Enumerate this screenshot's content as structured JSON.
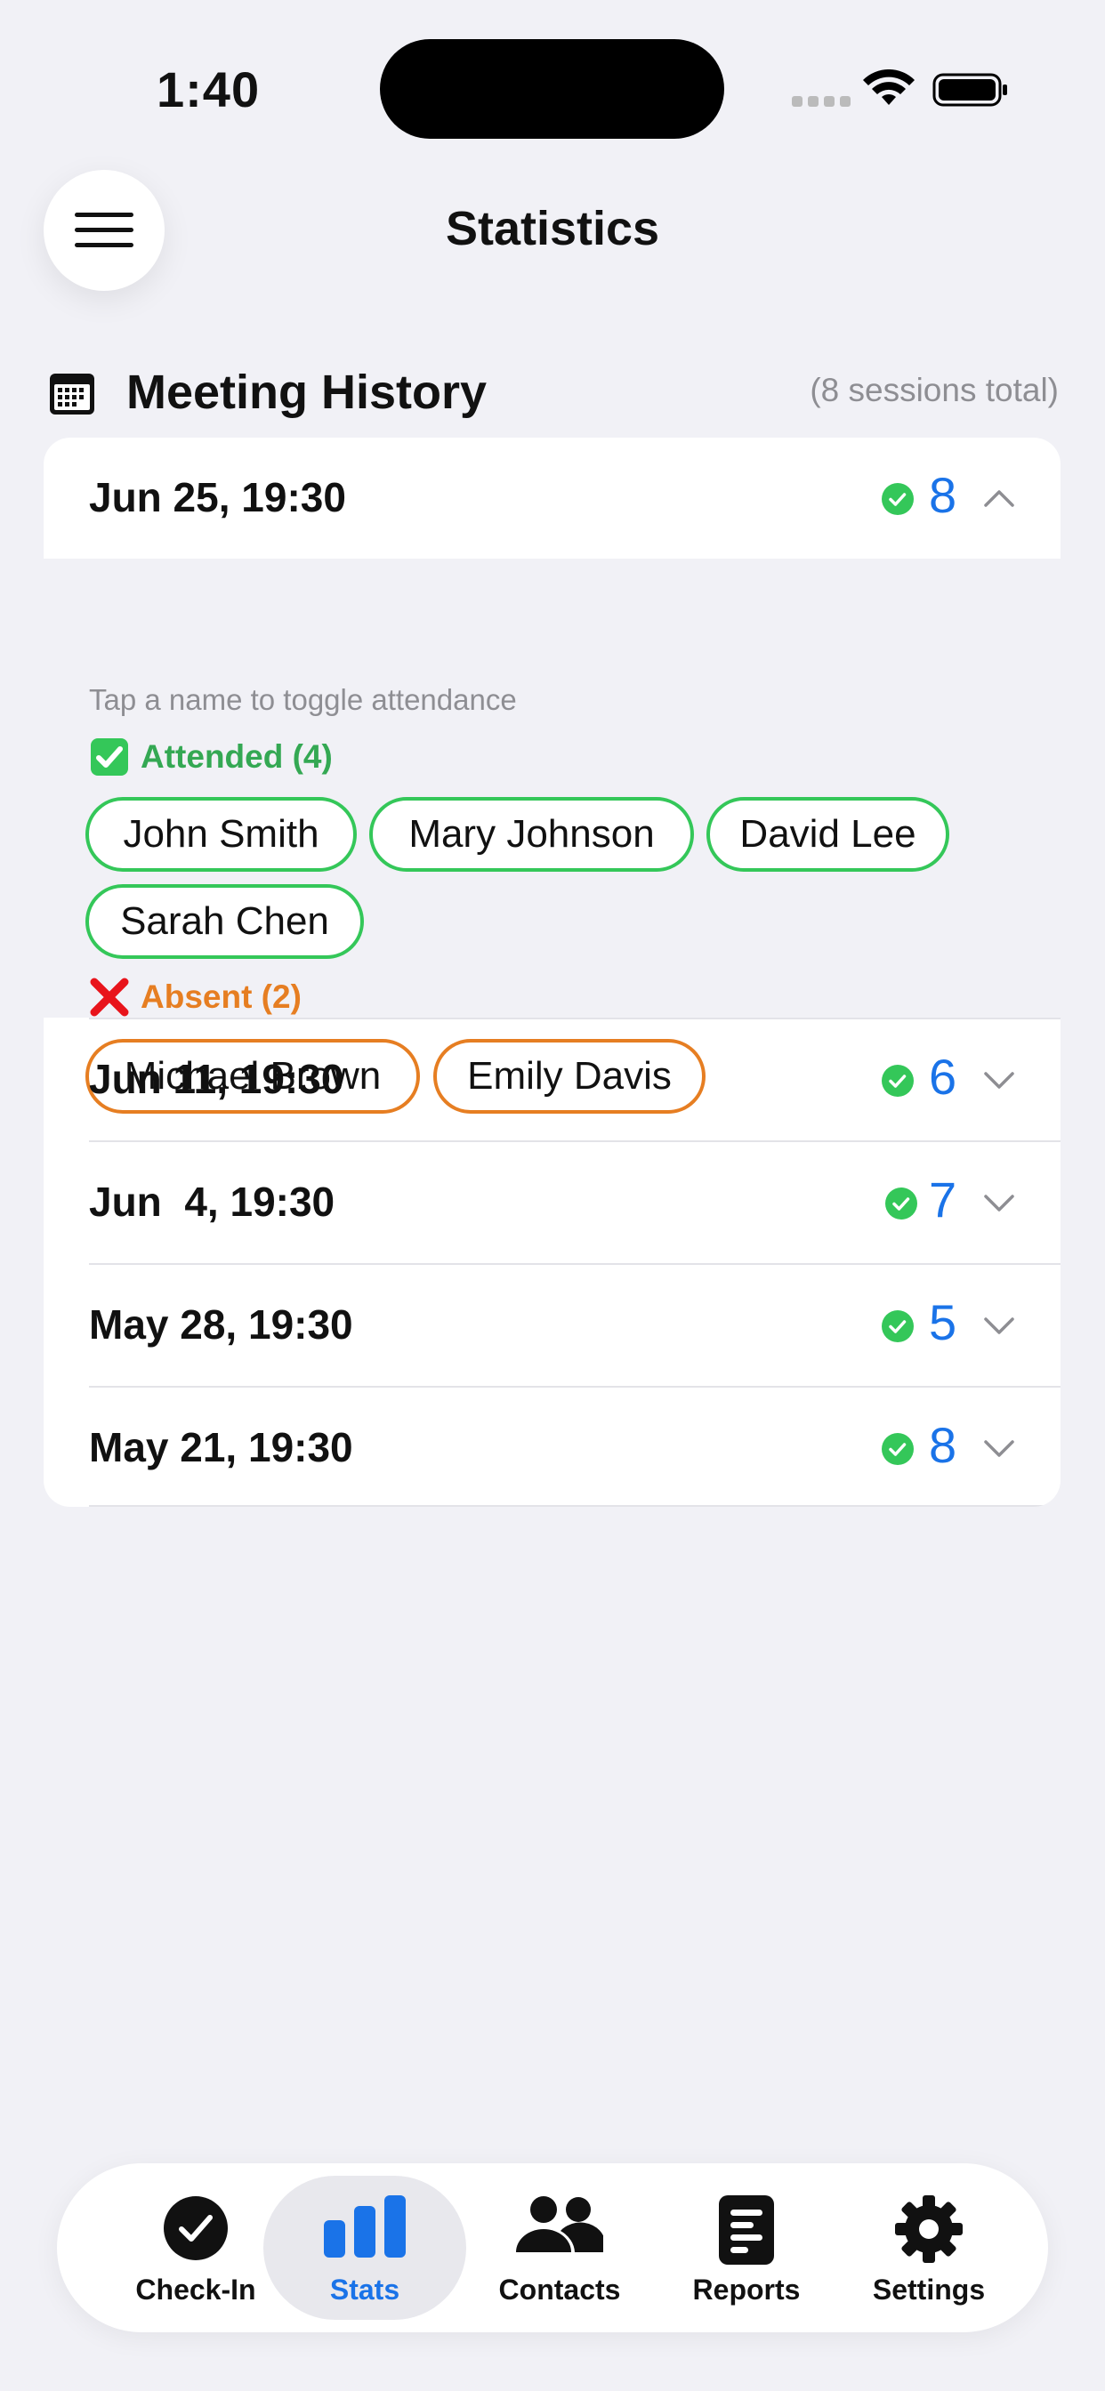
{
  "status_bar": {
    "time": "1:40"
  },
  "nav": {
    "title": "Statistics"
  },
  "section": {
    "title": "Meeting History",
    "count": "(8 sessions total)"
  },
  "sessions": [
    {
      "date": "Jun 25, 19:30",
      "attended_count": "8",
      "expanded": true
    },
    {
      "date": "Jun 11, 19:30",
      "attended_count": "6",
      "expanded": false
    },
    {
      "date": "Jun  4, 19:30",
      "attended_count": "7",
      "expanded": false
    },
    {
      "date": "May 28, 19:30",
      "attended_count": "5",
      "expanded": false
    },
    {
      "date": "May 21, 19:30",
      "attended_count": "8",
      "expanded": false
    }
  ],
  "expanded_session": {
    "hint": "Tap a name to toggle attendance",
    "attended_label": "Attended (4)",
    "attended": [
      "John Smith",
      "Mary Johnson",
      "David Lee",
      "Sarah Chen"
    ],
    "absent_label": "Absent (2)",
    "absent": [
      "Michael Brown",
      "Emily Davis"
    ]
  },
  "tabs": [
    {
      "label": "Check-In",
      "icon": "checkmark-circle-icon",
      "active": false
    },
    {
      "label": "Stats",
      "icon": "bar-chart-icon",
      "active": true
    },
    {
      "label": "Contacts",
      "icon": "people-icon",
      "active": false
    },
    {
      "label": "Reports",
      "icon": "document-icon",
      "active": false
    },
    {
      "label": "Settings",
      "icon": "gear-icon",
      "active": false
    }
  ],
  "colors": {
    "accent": "#1a73e8",
    "attended": "#34c759",
    "absent": "#e67e22",
    "background": "#f1f1f6"
  }
}
